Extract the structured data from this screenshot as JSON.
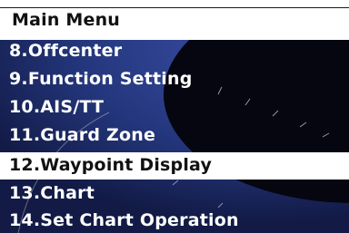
{
  "menu": {
    "title": "Main Menu",
    "items": [
      {
        "label": "8.Offcenter",
        "selected": false
      },
      {
        "label": "9.Function Setting",
        "selected": false
      },
      {
        "label": "10.AIS/TT",
        "selected": false
      },
      {
        "label": "11.Guard Zone",
        "selected": false
      },
      {
        "label": "12.Waypoint Display",
        "selected": true
      },
      {
        "label": "13.Chart",
        "selected": false
      },
      {
        "label": "14.Set Chart Operation",
        "selected": false
      }
    ]
  },
  "colors": {
    "menu_background": "#000000",
    "selected_background": "#ffffff",
    "text_normal": "#ffffff",
    "text_selected": "#111111",
    "radar_sweep": "#2a3d86"
  }
}
